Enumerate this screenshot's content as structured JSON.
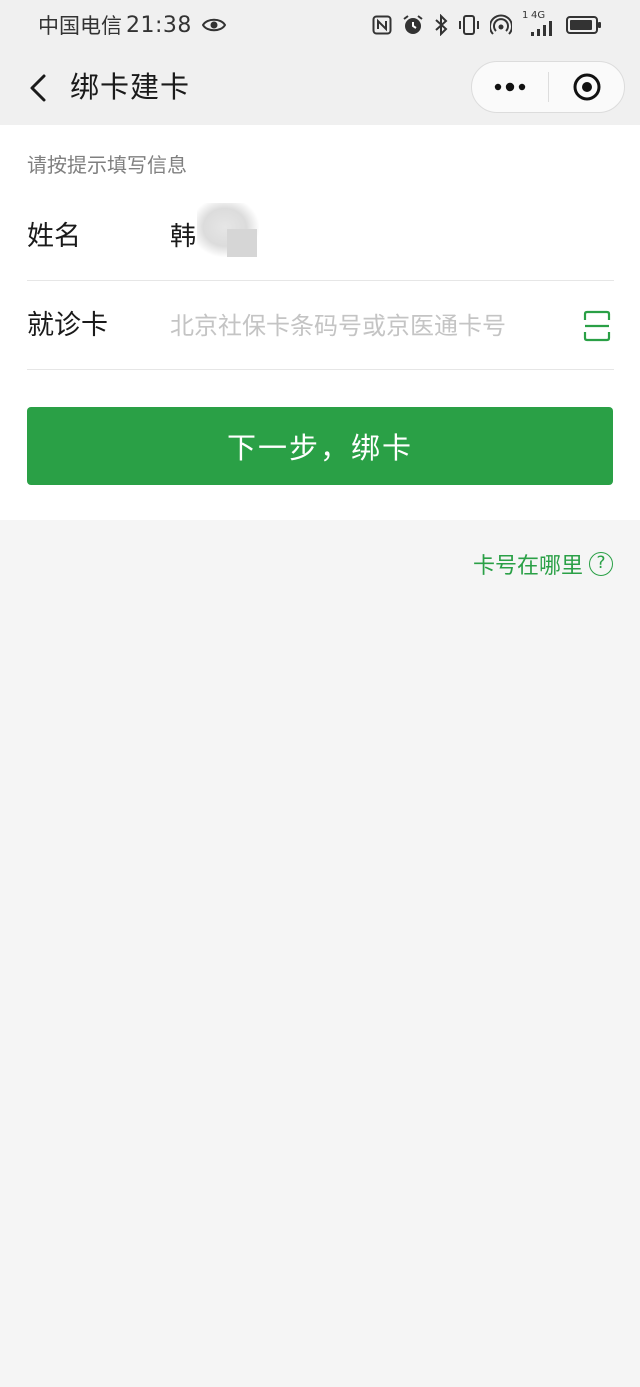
{
  "status_bar": {
    "carrier": "中国电信",
    "time": "21:38",
    "signal_label_top": "1",
    "network_type": "4G",
    "icons": [
      "eye-icon",
      "nfc-icon",
      "alarm-icon",
      "bluetooth-icon",
      "vibrate-icon",
      "hotspot-icon",
      "signal-icon",
      "battery-icon"
    ]
  },
  "nav": {
    "title": "绑卡建卡",
    "back_icon": "chevron-left-icon",
    "more_icon": "more-dots-icon",
    "close_icon": "target-close-icon"
  },
  "form": {
    "hint": "请按提示填写信息",
    "name_label": "姓名",
    "name_value": "韩",
    "card_label": "就诊卡",
    "card_placeholder": "北京社保卡条码号或京医通卡号",
    "card_value": "",
    "scan_icon": "scan-icon"
  },
  "actions": {
    "next_label": "下一步，绑卡",
    "where_label": "卡号在哪里",
    "help_glyph": "?"
  },
  "colors": {
    "accent": "#2aa046",
    "background": "#f5f5f5",
    "card": "#ffffff"
  }
}
